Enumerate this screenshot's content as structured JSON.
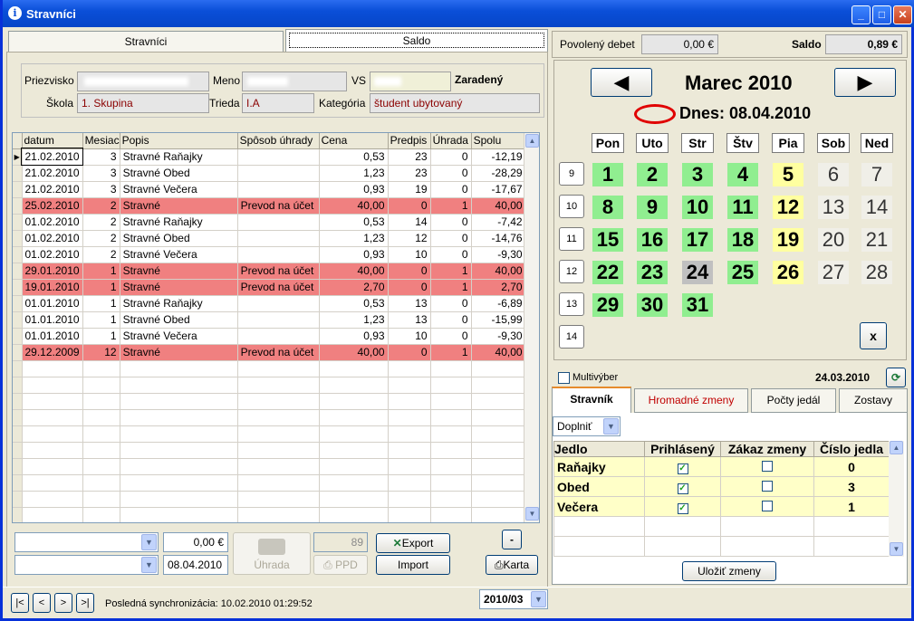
{
  "window": {
    "title": "Stravníci",
    "info_glyph": "i",
    "minimize": "_",
    "maximize": "□",
    "close": "✕"
  },
  "tabs": {
    "left": "Stravníci",
    "right": "Saldo"
  },
  "form": {
    "priezvisko_label": "Priezvisko",
    "meno_label": "Meno",
    "vs_label": "VS",
    "zaradeny_label": "Zaradený",
    "skola_label": "Škola",
    "skola_value": "1. Skupina",
    "trieda_label": "Trieda",
    "trieda_value": "I.A",
    "kategoria_label": "Kategória",
    "kategoria_value": "študent ubytovaný"
  },
  "grid": {
    "columns": [
      "datum",
      "Mesiac",
      "Popis",
      "Spôsob úhrady",
      "Cena",
      "Predpis",
      "Úhrada",
      "Spolu"
    ],
    "rows": [
      {
        "datum": "21.02.2010",
        "mesiac": "3",
        "popis": "Stravné Raňajky",
        "sposob": "",
        "cena": "0,53",
        "predpis": "23",
        "uhrada": "0",
        "spolu": "-12,19",
        "pay": false,
        "sel": true
      },
      {
        "datum": "21.02.2010",
        "mesiac": "3",
        "popis": "Stravné Obed",
        "sposob": "",
        "cena": "1,23",
        "predpis": "23",
        "uhrada": "0",
        "spolu": "-28,29",
        "pay": false
      },
      {
        "datum": "21.02.2010",
        "mesiac": "3",
        "popis": "Stravné Večera",
        "sposob": "",
        "cena": "0,93",
        "predpis": "19",
        "uhrada": "0",
        "spolu": "-17,67",
        "pay": false
      },
      {
        "datum": "25.02.2010",
        "mesiac": "2",
        "popis": "Stravné",
        "sposob": "Prevod na účet",
        "cena": "40,00",
        "predpis": "0",
        "uhrada": "1",
        "spolu": "40,00",
        "pay": true
      },
      {
        "datum": "01.02.2010",
        "mesiac": "2",
        "popis": "Stravné Raňajky",
        "sposob": "",
        "cena": "0,53",
        "predpis": "14",
        "uhrada": "0",
        "spolu": "-7,42",
        "pay": false
      },
      {
        "datum": "01.02.2010",
        "mesiac": "2",
        "popis": "Stravné Obed",
        "sposob": "",
        "cena": "1,23",
        "predpis": "12",
        "uhrada": "0",
        "spolu": "-14,76",
        "pay": false
      },
      {
        "datum": "01.02.2010",
        "mesiac": "2",
        "popis": "Stravné Večera",
        "sposob": "",
        "cena": "0,93",
        "predpis": "10",
        "uhrada": "0",
        "spolu": "-9,30",
        "pay": false
      },
      {
        "datum": "29.01.2010",
        "mesiac": "1",
        "popis": "Stravné",
        "sposob": "Prevod na účet",
        "cena": "40,00",
        "predpis": "0",
        "uhrada": "1",
        "spolu": "40,00",
        "pay": true
      },
      {
        "datum": "19.01.2010",
        "mesiac": "1",
        "popis": "Stravné",
        "sposob": "Prevod na účet",
        "cena": "2,70",
        "predpis": "0",
        "uhrada": "1",
        "spolu": "2,70",
        "pay": true
      },
      {
        "datum": "01.01.2010",
        "mesiac": "1",
        "popis": "Stravné Raňajky",
        "sposob": "",
        "cena": "0,53",
        "predpis": "13",
        "uhrada": "0",
        "spolu": "-6,89",
        "pay": false
      },
      {
        "datum": "01.01.2010",
        "mesiac": "1",
        "popis": "Stravné Obed",
        "sposob": "",
        "cena": "1,23",
        "predpis": "13",
        "uhrada": "0",
        "spolu": "-15,99",
        "pay": false
      },
      {
        "datum": "01.01.2010",
        "mesiac": "1",
        "popis": "Stravné Večera",
        "sposob": "",
        "cena": "0,93",
        "predpis": "10",
        "uhrada": "0",
        "spolu": "-9,30",
        "pay": false
      },
      {
        "datum": "29.12.2009",
        "mesiac": "12",
        "popis": "Stravné",
        "sposob": "Prevod na účet",
        "cena": "40,00",
        "predpis": "0",
        "uhrada": "1",
        "spolu": "40,00",
        "pay": true
      }
    ]
  },
  "bottom": {
    "amount": "0,00 €",
    "date": "08.04.2010",
    "uhrada_label": "Úhrada",
    "count": "89",
    "ppd_label": "PPD",
    "export_label": "Export",
    "import_label": "Import",
    "minus_label": "-",
    "karta_label": "Karta",
    "nav": [
      "|<",
      "<",
      ">",
      ">|"
    ],
    "sync_text": "Posledná synchronizácia: 10.02.2010 01:29:52",
    "period": "2010/03"
  },
  "right_top": {
    "debet_label": "Povolený debet",
    "debet_value": "0,00 €",
    "saldo_label": "Saldo",
    "saldo_value": "0,89 €"
  },
  "calendar": {
    "month": "Marec 2010",
    "today_text": "Dnes: 08.04.2010",
    "dow": [
      "Pon",
      "Uto",
      "Str",
      "Štv",
      "Pia",
      "Sob",
      "Ned"
    ],
    "weeks": [
      "9",
      "10",
      "11",
      "12",
      "13",
      "14"
    ],
    "clear_label": "x",
    "multivyber_label": "Multivýber",
    "selected_date": "24.03.2010"
  },
  "meal_tabs": [
    "Stravník",
    "Hromadné zmeny",
    "Počty jedál",
    "Zostavy"
  ],
  "meal": {
    "mode": "Doplniť",
    "columns": [
      "Jedlo",
      "Prihlásený",
      "Zákaz zmeny",
      "Číslo jedla"
    ],
    "rows": [
      {
        "jedlo": "Raňajky",
        "prihlaseny": true,
        "zakaz": false,
        "cislo": "0"
      },
      {
        "jedlo": "Obed",
        "prihlaseny": true,
        "zakaz": false,
        "cislo": "3"
      },
      {
        "jedlo": "Večera",
        "prihlaseny": true,
        "zakaz": false,
        "cislo": "1"
      }
    ],
    "save_label": "Uložiť zmeny"
  },
  "colors": {
    "payment_row": "#f08080",
    "green_day": "#90ee90",
    "yellow_day": "#ffffa0",
    "today_day": "#c0c0c0",
    "meal_row": "#ffffc8"
  }
}
